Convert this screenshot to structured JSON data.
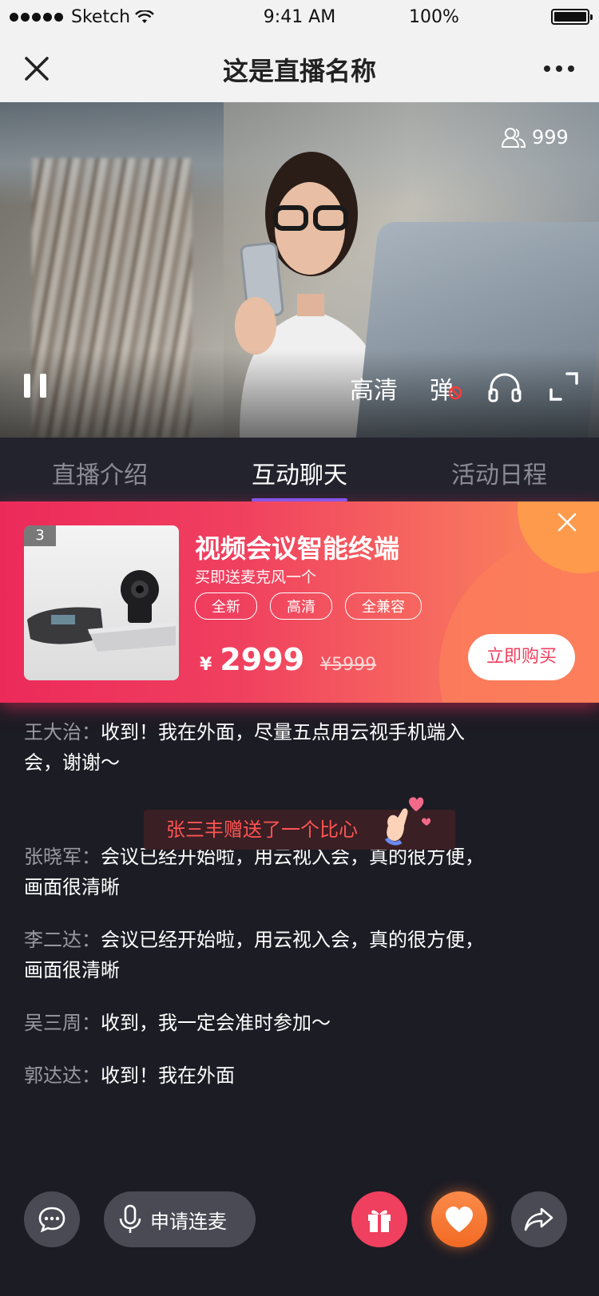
{
  "status_bar": {
    "carrier": "Sketch",
    "time": "9:41 AM",
    "battery": "100%"
  },
  "nav": {
    "title": "这是直播名称"
  },
  "video": {
    "viewer_count": "999",
    "quality_label": "高清",
    "danmu_label": "弹"
  },
  "tabs": [
    {
      "label": "直播介绍"
    },
    {
      "label": "互动聊天",
      "active": true
    },
    {
      "label": "活动日程"
    }
  ],
  "promo": {
    "badge": "3",
    "name": "视频会议智能终端",
    "subtitle": "买即送麦克风一个",
    "tags": [
      "全新",
      "高清",
      "全兼容"
    ],
    "currency": "¥",
    "price": "2999",
    "original_price": "¥5999",
    "buy_label": "立即购买"
  },
  "chat": [
    {
      "user": "王大治：",
      "text": "收到！我在外面，尽量五点用云视手机端入会，谢谢～"
    },
    {
      "user": "张晓军：",
      "text": "会议已经开始啦，用云视入会，真的很方便，画面很清晰"
    },
    {
      "user": "李二达：",
      "text": "会议已经开始啦，用云视入会，真的很方便，画面很清晰"
    },
    {
      "user": "吴三周：",
      "text": "收到，我一定会准时参加～"
    },
    {
      "user": "郭达达：",
      "text": "收到！我在外面"
    }
  ],
  "gift_notice": "张三丰赠送了一个比心",
  "bottom": {
    "mic_label": "申请连麦"
  },
  "colors": {
    "accent": "#f0405f",
    "tab_indicator": "#7a5cff",
    "like": "#f26a24"
  }
}
